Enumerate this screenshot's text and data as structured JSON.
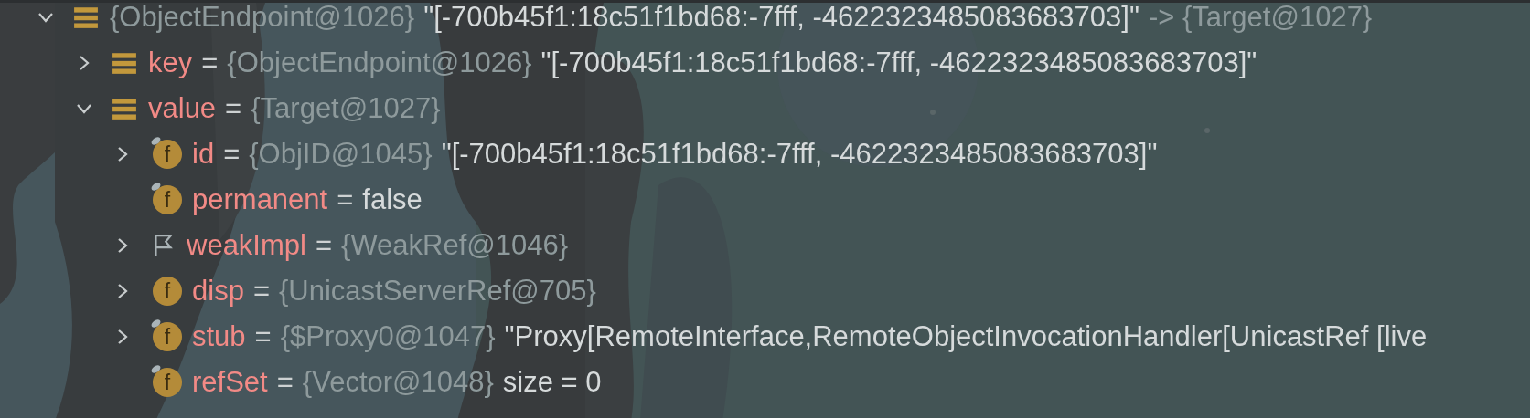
{
  "tree": [
    {
      "kind": "object",
      "expanded": true,
      "type": "{ObjectEndpoint@1026}",
      "value": "\"[-700b45f1:18c51f1bd68:-7fff, -4622323485083683703]\"",
      "suffix": "-> {Target@1027}",
      "children": [
        {
          "kind": "object",
          "expanded": false,
          "name": "key",
          "operator": "=",
          "type": "{ObjectEndpoint@1026}",
          "value": "\"[-700b45f1:18c51f1bd68:-7fff, -4622323485083683703]\""
        },
        {
          "kind": "object",
          "expanded": true,
          "name": "value",
          "operator": "=",
          "type": "{Target@1027}",
          "children": [
            {
              "kind": "field",
              "icon_text": "f",
              "final": true,
              "expanded": false,
              "name": "id",
              "operator": "=",
              "type": "{ObjID@1045}",
              "value": "\"[-700b45f1:18c51f1bd68:-7fff, -4622323485083683703]\""
            },
            {
              "kind": "field",
              "icon_text": "f",
              "final": true,
              "name": "permanent",
              "operator": "=",
              "value": "false"
            },
            {
              "kind": "flag",
              "expanded": false,
              "name": "weakImpl",
              "operator": "=",
              "type": "{WeakRef@1046}"
            },
            {
              "kind": "field",
              "icon_text": "f",
              "final": false,
              "expanded": false,
              "name": "disp",
              "operator": "=",
              "type": "{UnicastServerRef@705}"
            },
            {
              "kind": "field",
              "icon_text": "f",
              "final": true,
              "expanded": false,
              "name": "stub",
              "operator": "=",
              "type": "{$Proxy0@1047}",
              "value": "\"Proxy[RemoteInterface,RemoteObjectInvocationHandler[UnicastRef [live"
            },
            {
              "kind": "field",
              "icon_text": "f",
              "final": true,
              "name": "refSet",
              "operator": "=",
              "type": "{Vector@1048}",
              "value": "size = 0"
            }
          ]
        }
      ]
    }
  ]
}
